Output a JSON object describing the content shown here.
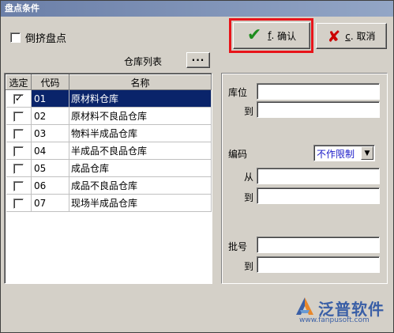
{
  "window": {
    "title": "盘点条件"
  },
  "options": {
    "reverse_label": "倒挤盘点",
    "reverse_checked": false
  },
  "toolbar": {
    "ok_label": "确认",
    "ok_key": "f",
    "cancel_label": "取消",
    "cancel_key": "c"
  },
  "warehouse": {
    "list_label": "仓库列表",
    "more_label": "···",
    "columns": [
      "选定",
      "代码",
      "名称"
    ],
    "rows": [
      {
        "checked": true,
        "code": "01",
        "name": "原材料仓库",
        "selected": true
      },
      {
        "checked": false,
        "code": "02",
        "name": "原材料不良品仓库",
        "selected": false
      },
      {
        "checked": false,
        "code": "03",
        "name": "物料半成品仓库",
        "selected": false
      },
      {
        "checked": false,
        "code": "04",
        "name": "半成品不良品仓库",
        "selected": false
      },
      {
        "checked": false,
        "code": "05",
        "name": "成品仓库",
        "selected": false
      },
      {
        "checked": false,
        "code": "06",
        "name": "成品不良品仓库",
        "selected": false
      },
      {
        "checked": false,
        "code": "07",
        "name": "现场半成品仓库",
        "selected": false
      }
    ]
  },
  "filters": {
    "location_label": "库位",
    "location_to_label": "到",
    "code_label": "编码",
    "code_mode": "不作限制",
    "code_from_label": "从",
    "code_to_label": "到",
    "batch_label": "批号",
    "batch_to_label": "到",
    "location_from": "",
    "location_to": "",
    "code_from": "",
    "code_to": "",
    "batch_from": "",
    "batch_to": ""
  },
  "branding": {
    "name": "泛普软件",
    "url": "www.fanpusoft.com"
  },
  "colors": {
    "selection": "#0a246a",
    "highlight_frame": "#e8141a",
    "ok_icon": "#1e8c1e",
    "cancel_icon": "#cc0000",
    "brand": "#3a5fa6"
  }
}
